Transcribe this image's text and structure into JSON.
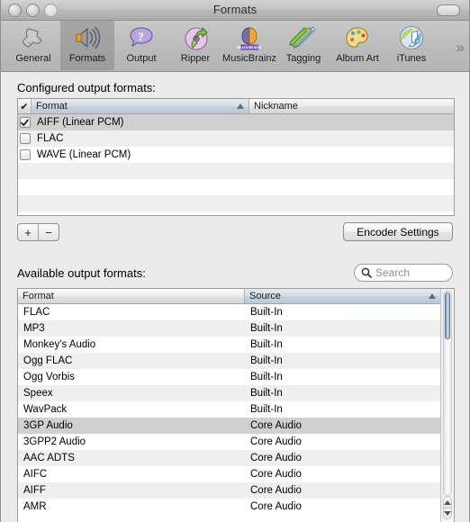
{
  "window": {
    "title": "Formats",
    "traffic_lights": [
      "close-button",
      "minimize-button",
      "zoom-button"
    ]
  },
  "toolbar": {
    "items": [
      {
        "label": "General",
        "icon": "wrench-icon",
        "selected": false
      },
      {
        "label": "Formats",
        "icon": "speaker-icon",
        "selected": true
      },
      {
        "label": "Output",
        "icon": "question-bubble-icon",
        "selected": false
      },
      {
        "label": "Ripper",
        "icon": "disc-arrow-icon",
        "selected": false
      },
      {
        "label": "MusicBrainz",
        "icon": "brain-icon",
        "selected": false
      },
      {
        "label": "Tagging",
        "icon": "pencils-icon",
        "selected": false
      },
      {
        "label": "Album Art",
        "icon": "palette-icon",
        "selected": false
      },
      {
        "label": "iTunes",
        "icon": "itunes-icon",
        "selected": false
      }
    ],
    "overflow_label": "»"
  },
  "configured": {
    "section_label": "Configured output formats:",
    "columns": [
      {
        "label": "✔",
        "key": "check",
        "sorted": false
      },
      {
        "label": "Format",
        "key": "format",
        "sorted": true
      },
      {
        "label": "Nickname",
        "key": "nickname",
        "sorted": false
      }
    ],
    "rows": [
      {
        "checked": true,
        "format": "AIFF (Linear PCM)",
        "nickname": "",
        "selected": true
      },
      {
        "checked": false,
        "format": "FLAC",
        "nickname": "",
        "selected": false
      },
      {
        "checked": false,
        "format": "WAVE (Linear PCM)",
        "nickname": "",
        "selected": false
      }
    ],
    "add_label": "+",
    "remove_label": "−",
    "encoder_settings_label": "Encoder Settings"
  },
  "available": {
    "section_label": "Available output formats:",
    "search_placeholder": "Search",
    "columns": [
      {
        "label": "Format",
        "key": "format",
        "sorted": false
      },
      {
        "label": "Source",
        "key": "source",
        "sorted": true
      }
    ],
    "rows": [
      {
        "format": "FLAC",
        "source": "Built-In",
        "selected": false
      },
      {
        "format": "MP3",
        "source": "Built-In",
        "selected": false
      },
      {
        "format": "Monkey's Audio",
        "source": "Built-In",
        "selected": false
      },
      {
        "format": "Ogg FLAC",
        "source": "Built-In",
        "selected": false
      },
      {
        "format": "Ogg Vorbis",
        "source": "Built-In",
        "selected": false
      },
      {
        "format": "Speex",
        "source": "Built-In",
        "selected": false
      },
      {
        "format": "WavPack",
        "source": "Built-In",
        "selected": false
      },
      {
        "format": "3GP Audio",
        "source": "Core Audio",
        "selected": true
      },
      {
        "format": "3GPP2 Audio",
        "source": "Core Audio",
        "selected": false
      },
      {
        "format": "AAC ADTS",
        "source": "Core Audio",
        "selected": false
      },
      {
        "format": "AIFC",
        "source": "Core Audio",
        "selected": false
      },
      {
        "format": "AIFF",
        "source": "Core Audio",
        "selected": false
      },
      {
        "format": "AMR",
        "source": "Core Audio",
        "selected": false
      }
    ]
  },
  "colors": {
    "window_bg": "#ebebeb",
    "selection": "#d0d0d0",
    "sorted_header": "#c6d1de",
    "scroll_thumb": "#8ea9c4"
  }
}
